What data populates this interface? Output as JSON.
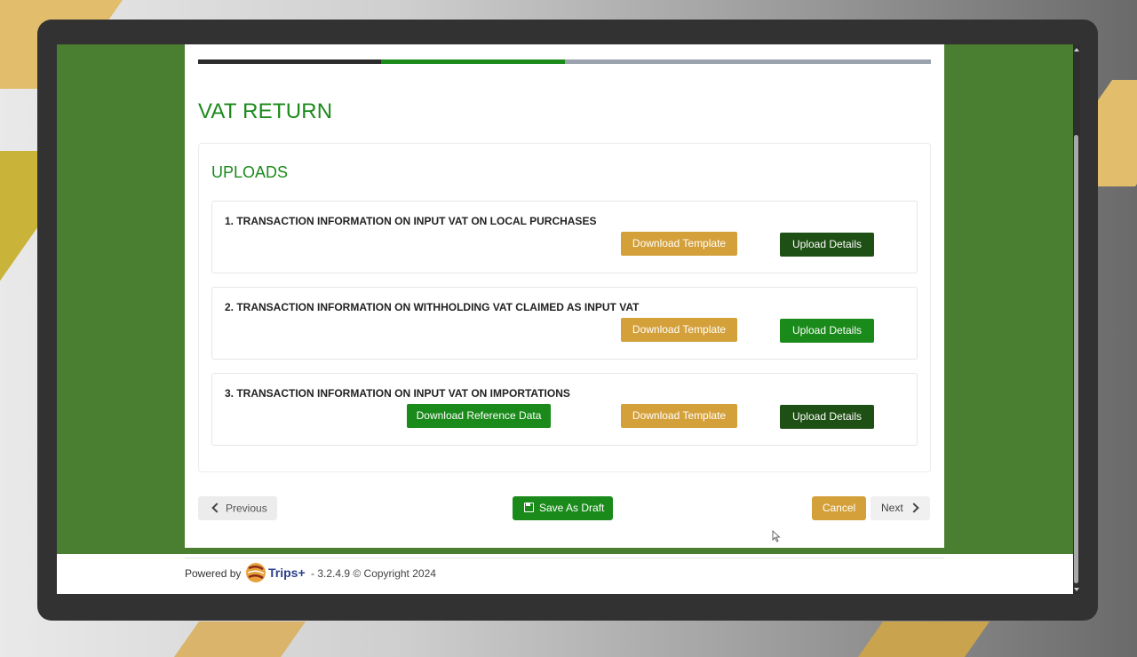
{
  "page": {
    "title": "VAT RETURN",
    "section_title": "UPLOADS",
    "progress": {
      "steps": 3,
      "current_step": 2
    }
  },
  "uploads": {
    "items": [
      {
        "label": "1. TRANSACTION INFORMATION ON INPUT VAT ON LOCAL PURCHASES",
        "download_template": "Download Template",
        "upload_details": "Upload Details"
      },
      {
        "label": "2. TRANSACTION INFORMATION ON WITHHOLDING VAT CLAIMED AS INPUT VAT",
        "download_template": "Download Template",
        "upload_details": "Upload Details"
      },
      {
        "label": "3. TRANSACTION INFORMATION ON INPUT VAT ON IMPORTATIONS",
        "download_reference": "Download Reference Data",
        "download_template": "Download Template",
        "upload_details": "Upload Details"
      }
    ]
  },
  "actions": {
    "previous": "Previous",
    "save_draft": "Save As Draft",
    "cancel": "Cancel",
    "next": "Next"
  },
  "footer": {
    "powered_by": "Powered by",
    "brand": "Trips+",
    "version": "- 3.2.4.9 © Copyright 2024"
  },
  "colors": {
    "green": "#1a8a1a",
    "dark_green": "#1e4f14",
    "gold": "#d4a03a",
    "background_green": "#4a7e31"
  }
}
